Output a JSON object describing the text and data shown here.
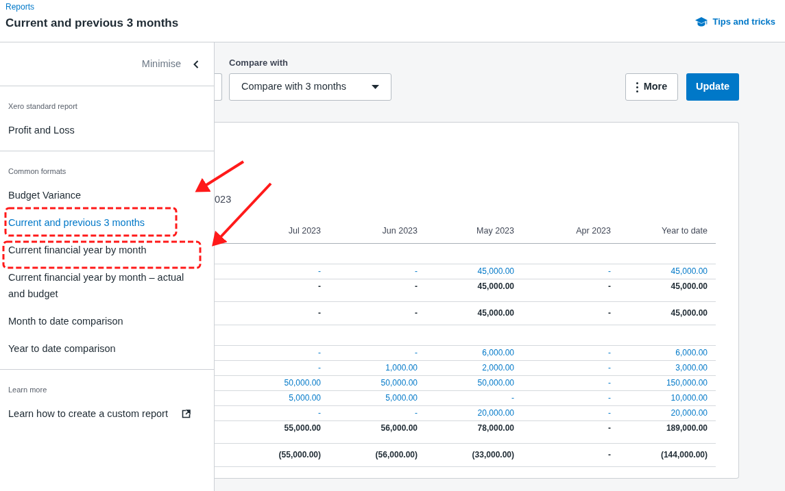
{
  "header": {
    "breadcrumb": "Reports",
    "title": "Current and previous 3 months",
    "tips_link": "Tips and tricks"
  },
  "sidebar": {
    "minimise": "Minimise",
    "sections": [
      {
        "heading": "Xero standard report",
        "items": [
          {
            "label": "Profit and Loss",
            "selected": false
          }
        ]
      },
      {
        "heading": "Common formats",
        "items": [
          {
            "label": "Budget Variance",
            "selected": false
          },
          {
            "label": "Current and previous 3 months",
            "selected": true
          },
          {
            "label": "Current financial year by month",
            "selected": false
          },
          {
            "label": "Current financial year by month – actual and budget",
            "selected": false
          },
          {
            "label": "Month to date comparison",
            "selected": false
          },
          {
            "label": "Year to date comparison",
            "selected": false
          }
        ]
      },
      {
        "heading": "Learn more",
        "items": [
          {
            "label": "Learn how to create a custom report",
            "selected": false,
            "external": true
          }
        ]
      }
    ]
  },
  "toolbar": {
    "compare_label": "Compare with",
    "compare_value": "Compare with 3 months",
    "more_button": "More",
    "update_button": "Update"
  },
  "report": {
    "date_fragment": "023",
    "columns": [
      "Jul 2023",
      "Jun 2023",
      "May 2023",
      "Apr 2023",
      "Year to date"
    ],
    "rows": [
      {
        "kind": "blank",
        "cells": []
      },
      {
        "kind": "amount",
        "cells": [
          "-",
          "-",
          "45,000.00",
          "-",
          "45,000.00"
        ]
      },
      {
        "kind": "subtotal",
        "cells": [
          "-",
          "-",
          "45,000.00",
          "-",
          "45,000.00"
        ]
      },
      {
        "kind": "total",
        "cells": [
          "-",
          "-",
          "45,000.00",
          "-",
          "45,000.00"
        ]
      },
      {
        "kind": "blank",
        "cells": []
      },
      {
        "kind": "amount",
        "cells": [
          "-",
          "-",
          "6,000.00",
          "-",
          "6,000.00"
        ]
      },
      {
        "kind": "amount",
        "cells": [
          "-",
          "1,000.00",
          "2,000.00",
          "-",
          "3,000.00"
        ]
      },
      {
        "kind": "amount",
        "cells": [
          "50,000.00",
          "50,000.00",
          "50,000.00",
          "-",
          "150,000.00"
        ]
      },
      {
        "kind": "amount",
        "cells": [
          "5,000.00",
          "5,000.00",
          "-",
          "-",
          "10,000.00"
        ]
      },
      {
        "kind": "amount",
        "cells": [
          "-",
          "-",
          "20,000.00",
          "-",
          "20,000.00"
        ]
      },
      {
        "kind": "subtotal",
        "cells": [
          "55,000.00",
          "56,000.00",
          "78,000.00",
          "-",
          "189,000.00"
        ]
      },
      {
        "kind": "total",
        "cells": [
          "(55,000.00)",
          "(56,000.00)",
          "(33,000.00)",
          "-",
          "(144,000.00)"
        ]
      }
    ]
  }
}
